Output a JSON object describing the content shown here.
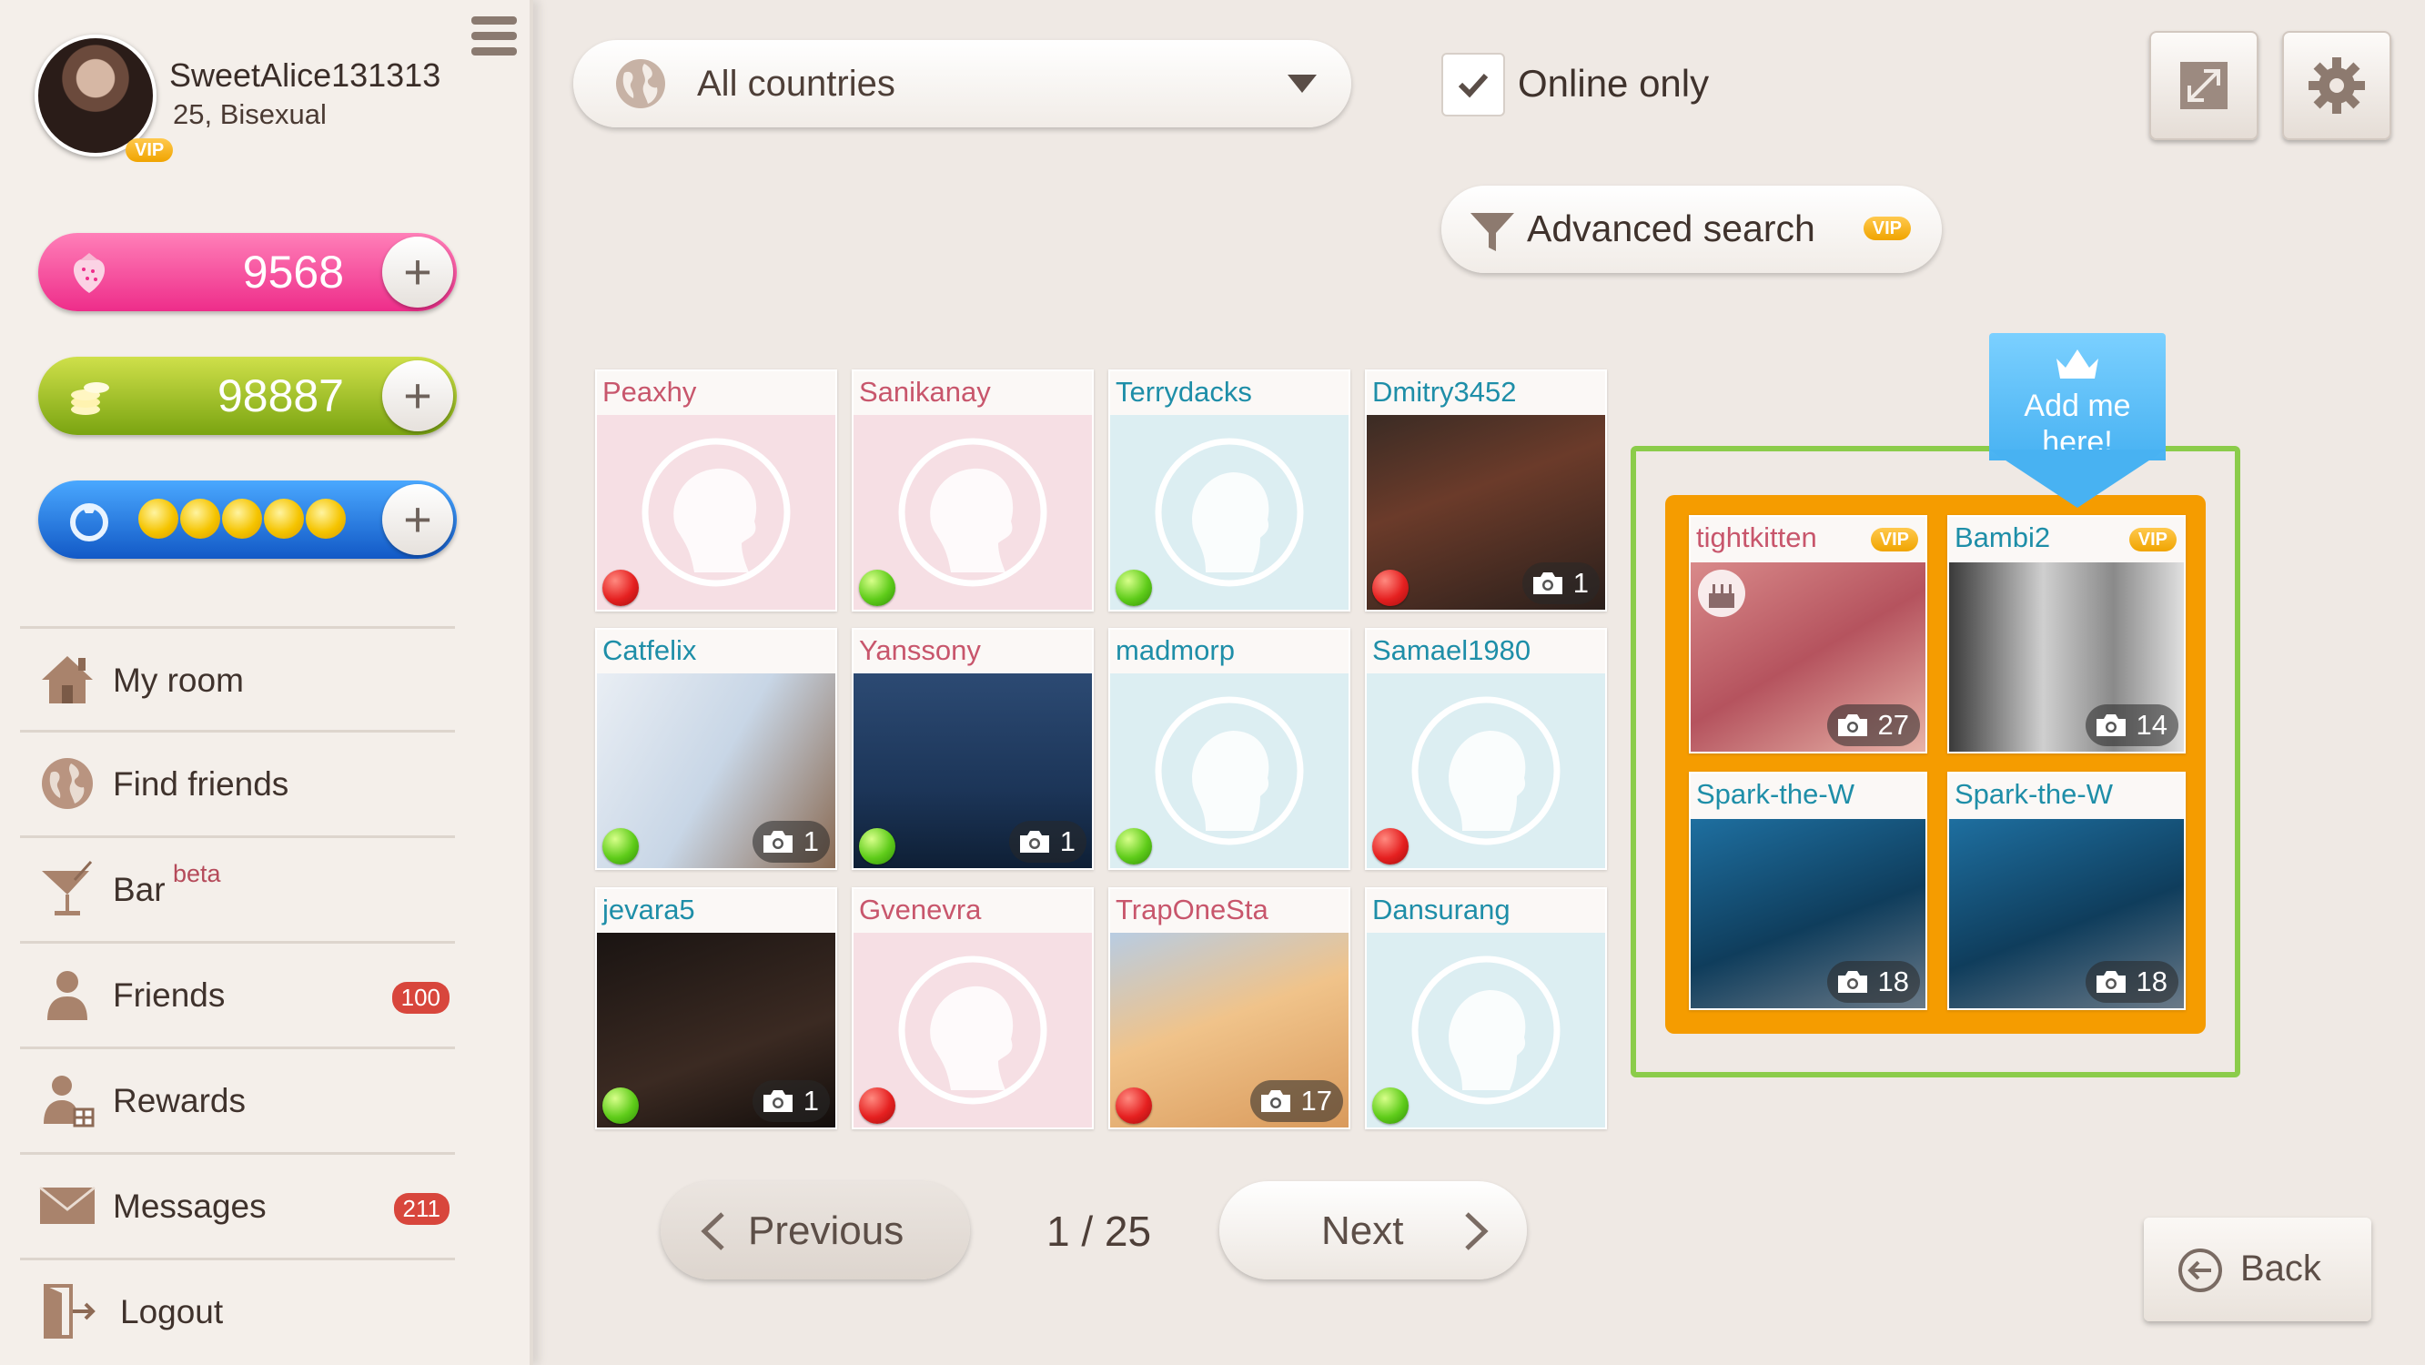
{
  "user": {
    "name": "SweetAlice131313",
    "subtitle": "25, Bisexual",
    "vip": "VIP"
  },
  "currencies": {
    "strawberries": "9568",
    "coins": "98887",
    "tokens_filled": 5
  },
  "nav": [
    {
      "label": "My room",
      "icon": "house-icon"
    },
    {
      "label": "Find friends",
      "icon": "globe-icon"
    },
    {
      "label": "Bar",
      "badge": "beta",
      "icon": "cocktail-icon"
    },
    {
      "label": "Friends",
      "count": "100",
      "icon": "person-icon"
    },
    {
      "label": "Rewards",
      "icon": "person-gift-icon"
    },
    {
      "label": "Messages",
      "count": "211",
      "icon": "envelope-icon"
    },
    {
      "label": "Logout",
      "icon": "door-exit-icon"
    }
  ],
  "filters": {
    "country": "All countries",
    "online_only_label": "Online only",
    "online_only_checked": true,
    "advanced_search_label": "Advanced search",
    "advanced_search_badge": "VIP"
  },
  "grid": [
    {
      "name": "Peaxhy",
      "gender": "female",
      "online": false,
      "photos": null
    },
    {
      "name": "Sanikanay",
      "gender": "female",
      "online": true,
      "photos": null
    },
    {
      "name": "Terrydacks",
      "gender": "male",
      "online": true,
      "photos": null
    },
    {
      "name": "Dmitry3452",
      "gender": "male",
      "online": false,
      "photos": "1"
    },
    {
      "name": "Catfelix",
      "gender": "male",
      "online": true,
      "photos": "1"
    },
    {
      "name": "Yanssony",
      "gender": "female",
      "online": true,
      "photos": "1"
    },
    {
      "name": "madmorp",
      "gender": "male",
      "online": true,
      "photos": null
    },
    {
      "name": "Samael1980",
      "gender": "male",
      "online": false,
      "photos": null
    },
    {
      "name": "jevara5",
      "gender": "male",
      "online": true,
      "photos": "1"
    },
    {
      "name": "Gvenevra",
      "gender": "female",
      "online": false,
      "photos": null
    },
    {
      "name": "TrapOneSta",
      "gender": "female",
      "online": false,
      "photos": "17"
    },
    {
      "name": "Dansurang",
      "gender": "male",
      "online": true,
      "photos": null
    }
  ],
  "promo": {
    "add_me_label": "Add me here!",
    "cards": [
      {
        "name": "tightkitten",
        "vip": "VIP",
        "photos": "27",
        "birthday": true
      },
      {
        "name": "Bambi2",
        "vip": "VIP",
        "photos": "14"
      },
      {
        "name": "Spark-the-W",
        "photos": "18"
      },
      {
        "name": "Spark-the-W",
        "photos": "18"
      }
    ]
  },
  "pagination": {
    "previous_label": "Previous",
    "next_label": "Next",
    "page": "1 / 25"
  },
  "back_label": "Back",
  "colors": {
    "female_name": "#c8566c",
    "male_name": "#1e8ea8",
    "female_bg": "#f6dfe4",
    "male_bg": "#dceef2",
    "promo_orange": "#f59c00",
    "promo_border": "#8bcc4a"
  }
}
